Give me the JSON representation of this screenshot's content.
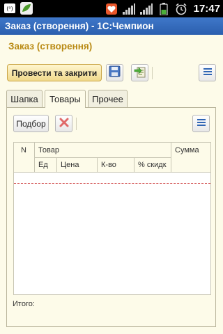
{
  "status_bar": {
    "time": "17:47",
    "icons": [
      "usb-debug-icon",
      "leaf-icon",
      "notification-icon",
      "signal-icon",
      "battery-icon",
      "alarm-icon"
    ]
  },
  "app": {
    "window_title": "Заказ (створення) - 1С:Чемпион",
    "form_title": "Заказ (створення)"
  },
  "toolbar": {
    "post_close_label": "Провести та закрити",
    "icons": [
      "save-icon",
      "post-icon",
      "menu-icon"
    ]
  },
  "tabs": [
    {
      "label": "Шапка",
      "active": false
    },
    {
      "label": "Товары",
      "active": true
    },
    {
      "label": "Прочее",
      "active": false
    }
  ],
  "goods": {
    "pick_label": "Подбор",
    "columns": {
      "n": "N",
      "product": "Товар",
      "sum": "Сумма",
      "unit": "Ед",
      "price": "Цена",
      "qty": "К-во",
      "discount": "% скидк"
    },
    "rows": [],
    "total_label": "Итого:"
  },
  "colors": {
    "title_bar": "#2f65b4",
    "form_title": "#b98a14",
    "background": "#fdfbe9"
  }
}
